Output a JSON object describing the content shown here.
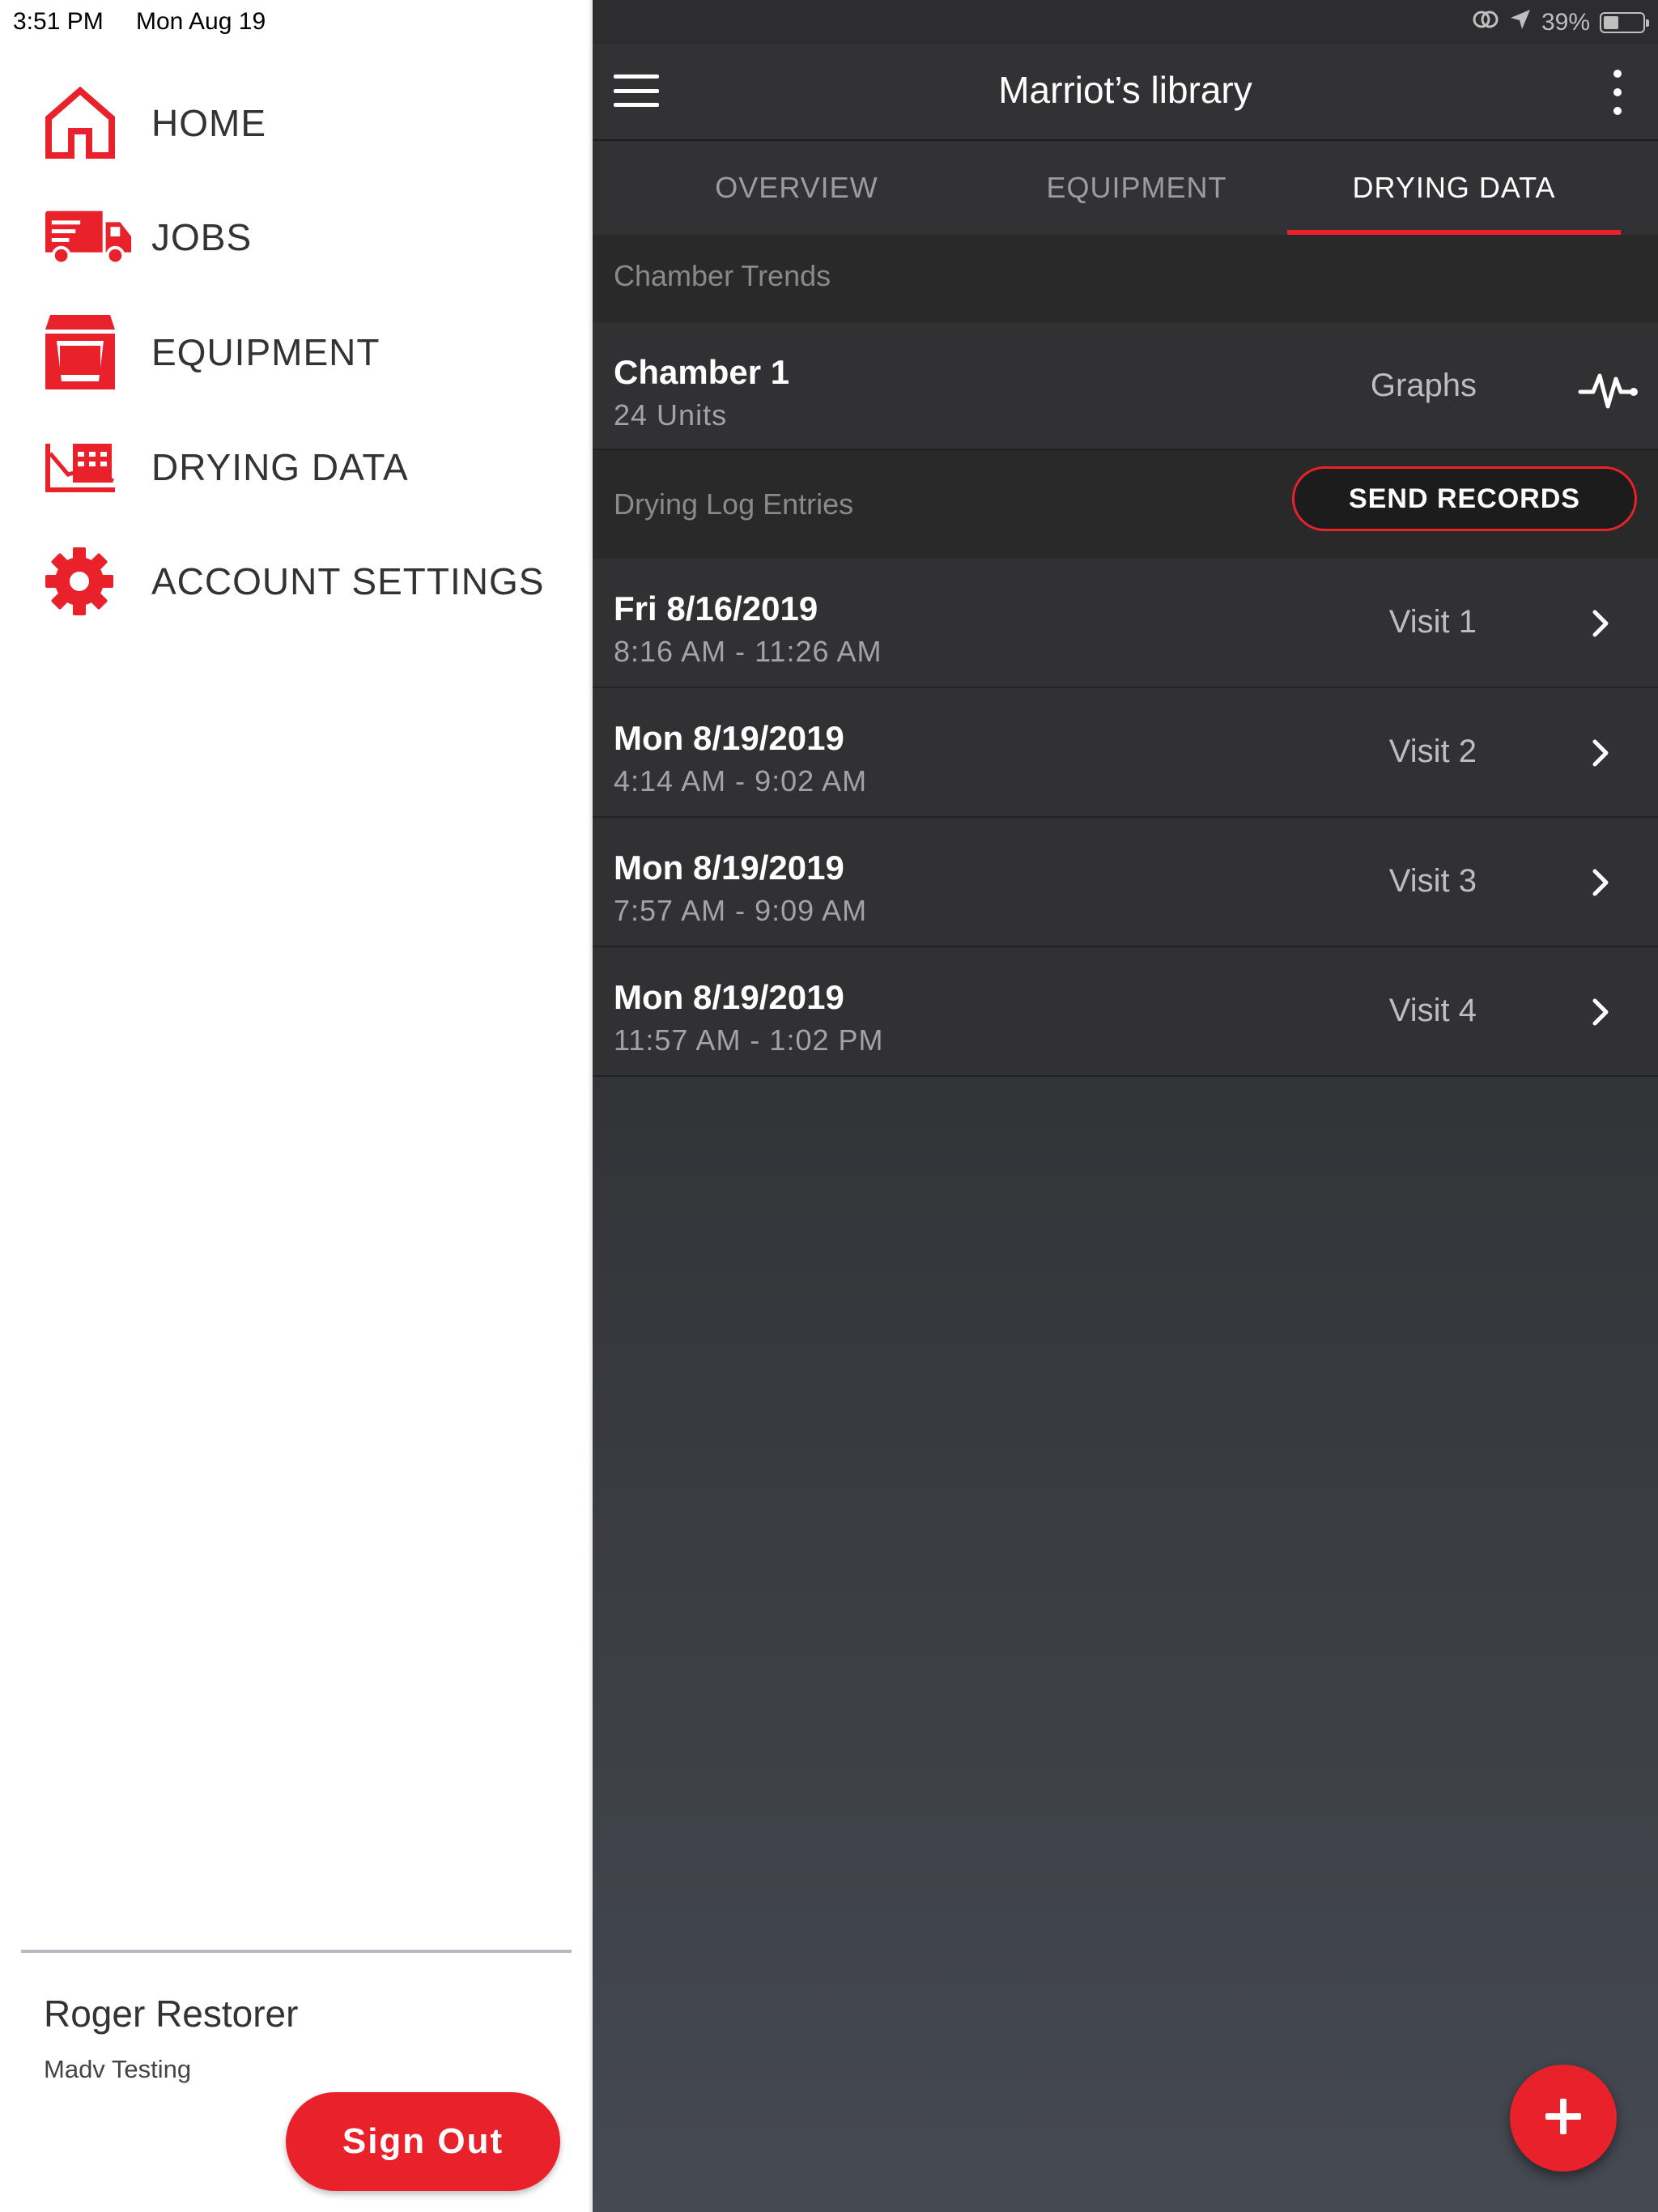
{
  "status_bar": {
    "time": "3:51 PM",
    "date": "Mon Aug 19",
    "battery": "39%",
    "battery_level": 0.39
  },
  "sidebar": {
    "accent_color": "#e8212b",
    "items": [
      {
        "label": "HOME",
        "icon": "home-icon"
      },
      {
        "label": "JOBS",
        "icon": "truck-icon"
      },
      {
        "label": "EQUIPMENT",
        "icon": "equipment-icon"
      },
      {
        "label": "DRYING DATA",
        "icon": "drying-data-icon"
      },
      {
        "label": "ACCOUNT SETTINGS",
        "icon": "gear-icon"
      }
    ],
    "user": {
      "name": "Roger Restorer",
      "org": "Madv Testing"
    },
    "sign_out_label": "Sign Out"
  },
  "header": {
    "title": "Marriot’s library"
  },
  "tabs": [
    {
      "label": "OVERVIEW",
      "active": false
    },
    {
      "label": "EQUIPMENT",
      "active": false
    },
    {
      "label": "DRYING DATA",
      "active": true
    }
  ],
  "chamber_trends": {
    "section_label": "Chamber Trends",
    "chamber": {
      "name": "Chamber 1",
      "units": "24 Units",
      "graphs_label": "Graphs"
    }
  },
  "drying_log": {
    "section_label": "Drying Log Entries",
    "send_records_label": "SEND RECORDS",
    "entries": [
      {
        "date": "Fri 8/16/2019",
        "time_range": "8:16 AM - 11:26 AM",
        "visit": "Visit 1"
      },
      {
        "date": "Mon 8/19/2019",
        "time_range": "4:14 AM - 9:02 AM",
        "visit": "Visit 2"
      },
      {
        "date": "Mon 8/19/2019",
        "time_range": "7:57 AM - 9:09 AM",
        "visit": "Visit 3"
      },
      {
        "date": "Mon 8/19/2019",
        "time_range": "11:57 AM - 1:02 PM",
        "visit": "Visit 4"
      }
    ]
  },
  "fab_icon": "plus-icon"
}
